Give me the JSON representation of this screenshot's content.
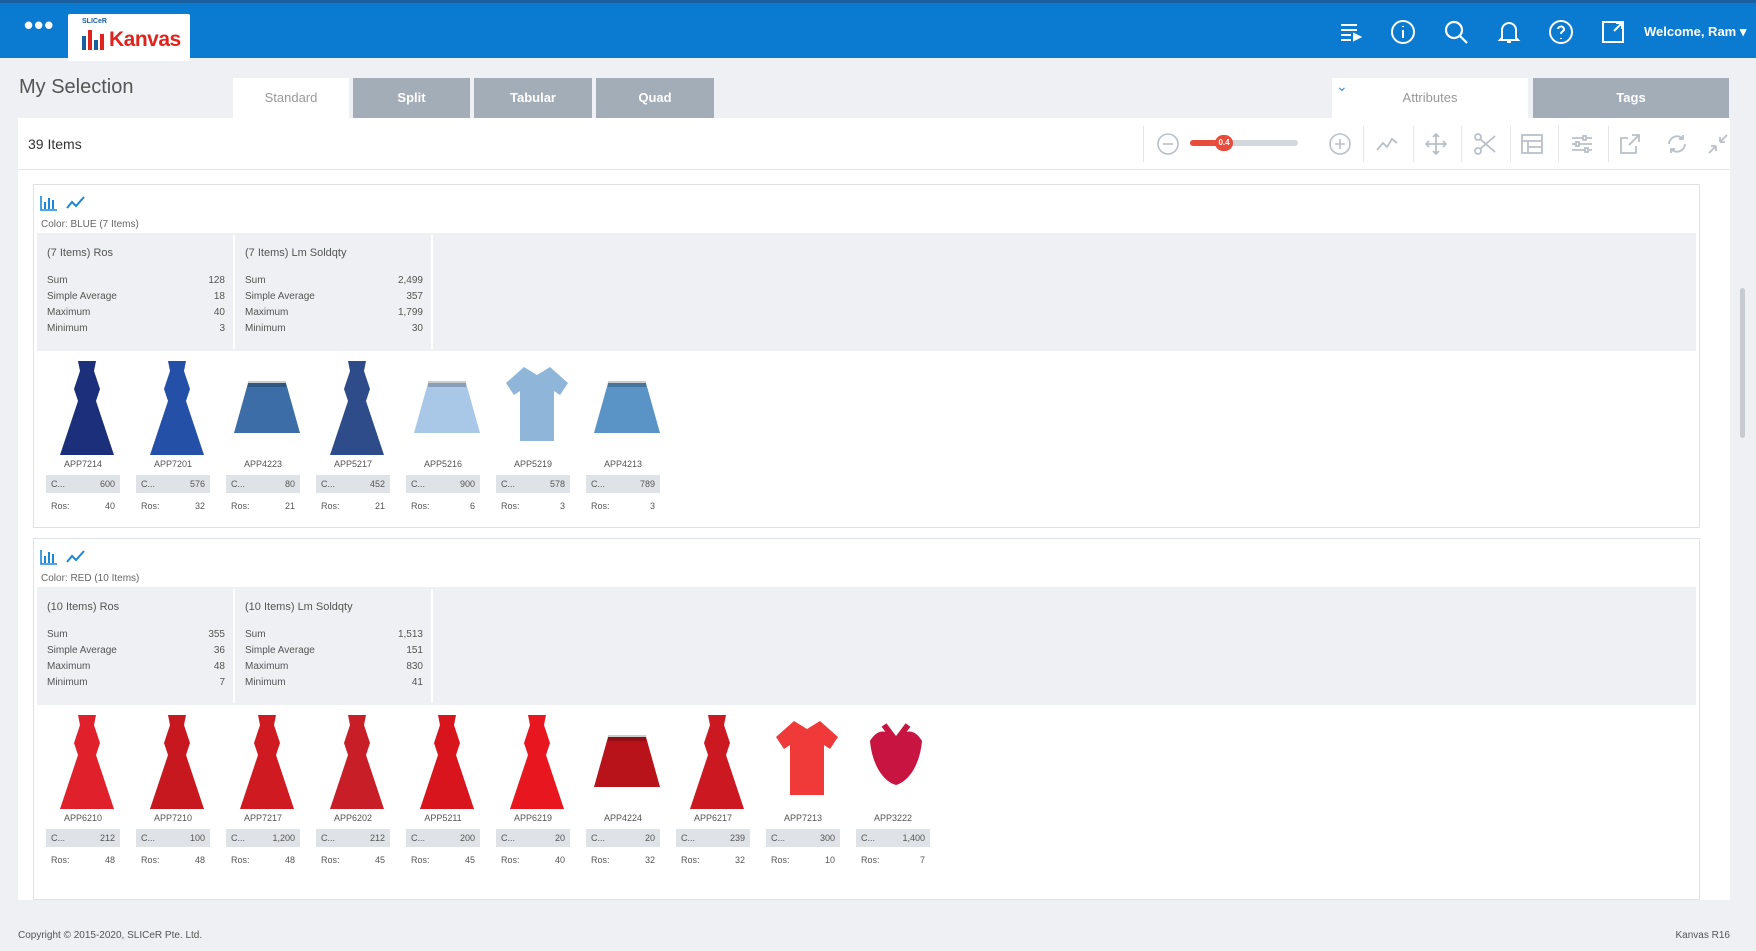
{
  "header": {
    "menu_icon": "more-dots-icon",
    "logo_small": "SLICeR",
    "logo_text": "Kanvas",
    "welcome": "Welcome, Ram",
    "icons": [
      "list-filter-icon",
      "info-icon",
      "search-icon",
      "bell-icon",
      "help-icon",
      "expand-window-icon"
    ]
  },
  "page": {
    "title": "My Selection"
  },
  "view_tabs": [
    "Standard",
    "Split",
    "Tabular",
    "Quad"
  ],
  "side_tabs": {
    "attributes": "Attributes",
    "tags": "Tags"
  },
  "toolbar": {
    "count": "39 Items",
    "zoom": "0.4",
    "zoom_level": 0.25
  },
  "groups": [
    {
      "label": "Color: BLUE (7 Items)",
      "stats": [
        {
          "title": "(7 Items) Ros",
          "rows": [
            [
              "Sum",
              "128"
            ],
            [
              "Simple Average",
              "18"
            ],
            [
              "Maximum",
              "40"
            ],
            [
              "Minimum",
              "3"
            ]
          ]
        },
        {
          "title": "(7 Items) Lm Soldqty",
          "rows": [
            [
              "Sum",
              "2,499"
            ],
            [
              "Simple Average",
              "357"
            ],
            [
              "Maximum",
              "1,799"
            ],
            [
              "Minimum",
              "30"
            ]
          ]
        }
      ],
      "items": [
        {
          "code": "APP7214",
          "c": "600",
          "ros": "40",
          "kind": "dress",
          "color": "#1b2f7a"
        },
        {
          "code": "APP7201",
          "c": "576",
          "ros": "32",
          "kind": "dress",
          "color": "#2450a8"
        },
        {
          "code": "APP4223",
          "c": "80",
          "ros": "21",
          "kind": "skirt",
          "color": "#3d6da6"
        },
        {
          "code": "APP5217",
          "c": "452",
          "ros": "21",
          "kind": "dress",
          "color": "#2e4b8a"
        },
        {
          "code": "APP5216",
          "c": "900",
          "ros": "6",
          "kind": "skirt",
          "color": "#a9c7e6"
        },
        {
          "code": "APP5219",
          "c": "578",
          "ros": "3",
          "kind": "top",
          "color": "#8fb6d9"
        },
        {
          "code": "APP4213",
          "c": "789",
          "ros": "3",
          "kind": "skirt",
          "color": "#5a93c6"
        }
      ]
    },
    {
      "label": "Color: RED (10 Items)",
      "stats": [
        {
          "title": "(10 Items) Ros",
          "rows": [
            [
              "Sum",
              "355"
            ],
            [
              "Simple Average",
              "36"
            ],
            [
              "Maximum",
              "48"
            ],
            [
              "Minimum",
              "7"
            ]
          ]
        },
        {
          "title": "(10 Items) Lm Soldqty",
          "rows": [
            [
              "Sum",
              "1,513"
            ],
            [
              "Simple Average",
              "151"
            ],
            [
              "Maximum",
              "830"
            ],
            [
              "Minimum",
              "41"
            ]
          ]
        }
      ],
      "items": [
        {
          "code": "APP6210",
          "c": "212",
          "ros": "48",
          "kind": "dress",
          "color": "#e0202a"
        },
        {
          "code": "APP7210",
          "c": "100",
          "ros": "48",
          "kind": "dress",
          "color": "#c8181f"
        },
        {
          "code": "APP7217",
          "c": "1,200",
          "ros": "48",
          "kind": "dress",
          "color": "#d01a22"
        },
        {
          "code": "APP6202",
          "c": "212",
          "ros": "45",
          "kind": "dress",
          "color": "#c81e28"
        },
        {
          "code": "APP5211",
          "c": "200",
          "ros": "45",
          "kind": "dress",
          "color": "#d8141c"
        },
        {
          "code": "APP6219",
          "c": "20",
          "ros": "40",
          "kind": "dress",
          "color": "#e8161e"
        },
        {
          "code": "APP4224",
          "c": "20",
          "ros": "32",
          "kind": "skirt",
          "color": "#b8121a"
        },
        {
          "code": "APP6217",
          "c": "239",
          "ros": "32",
          "kind": "dress",
          "color": "#cc1820"
        },
        {
          "code": "APP7213",
          "c": "300",
          "ros": "10",
          "kind": "top",
          "color": "#f03a3a"
        },
        {
          "code": "APP3222",
          "c": "1,400",
          "ros": "7",
          "kind": "bikini",
          "color": "#c81440"
        }
      ]
    }
  ],
  "metric_labels": {
    "c": "C...",
    "ros": "Ros:"
  },
  "footer": {
    "copyright": "Copyright © 2015-2020, SLICeR Pte. Ltd.",
    "version": "Kanvas R16"
  }
}
